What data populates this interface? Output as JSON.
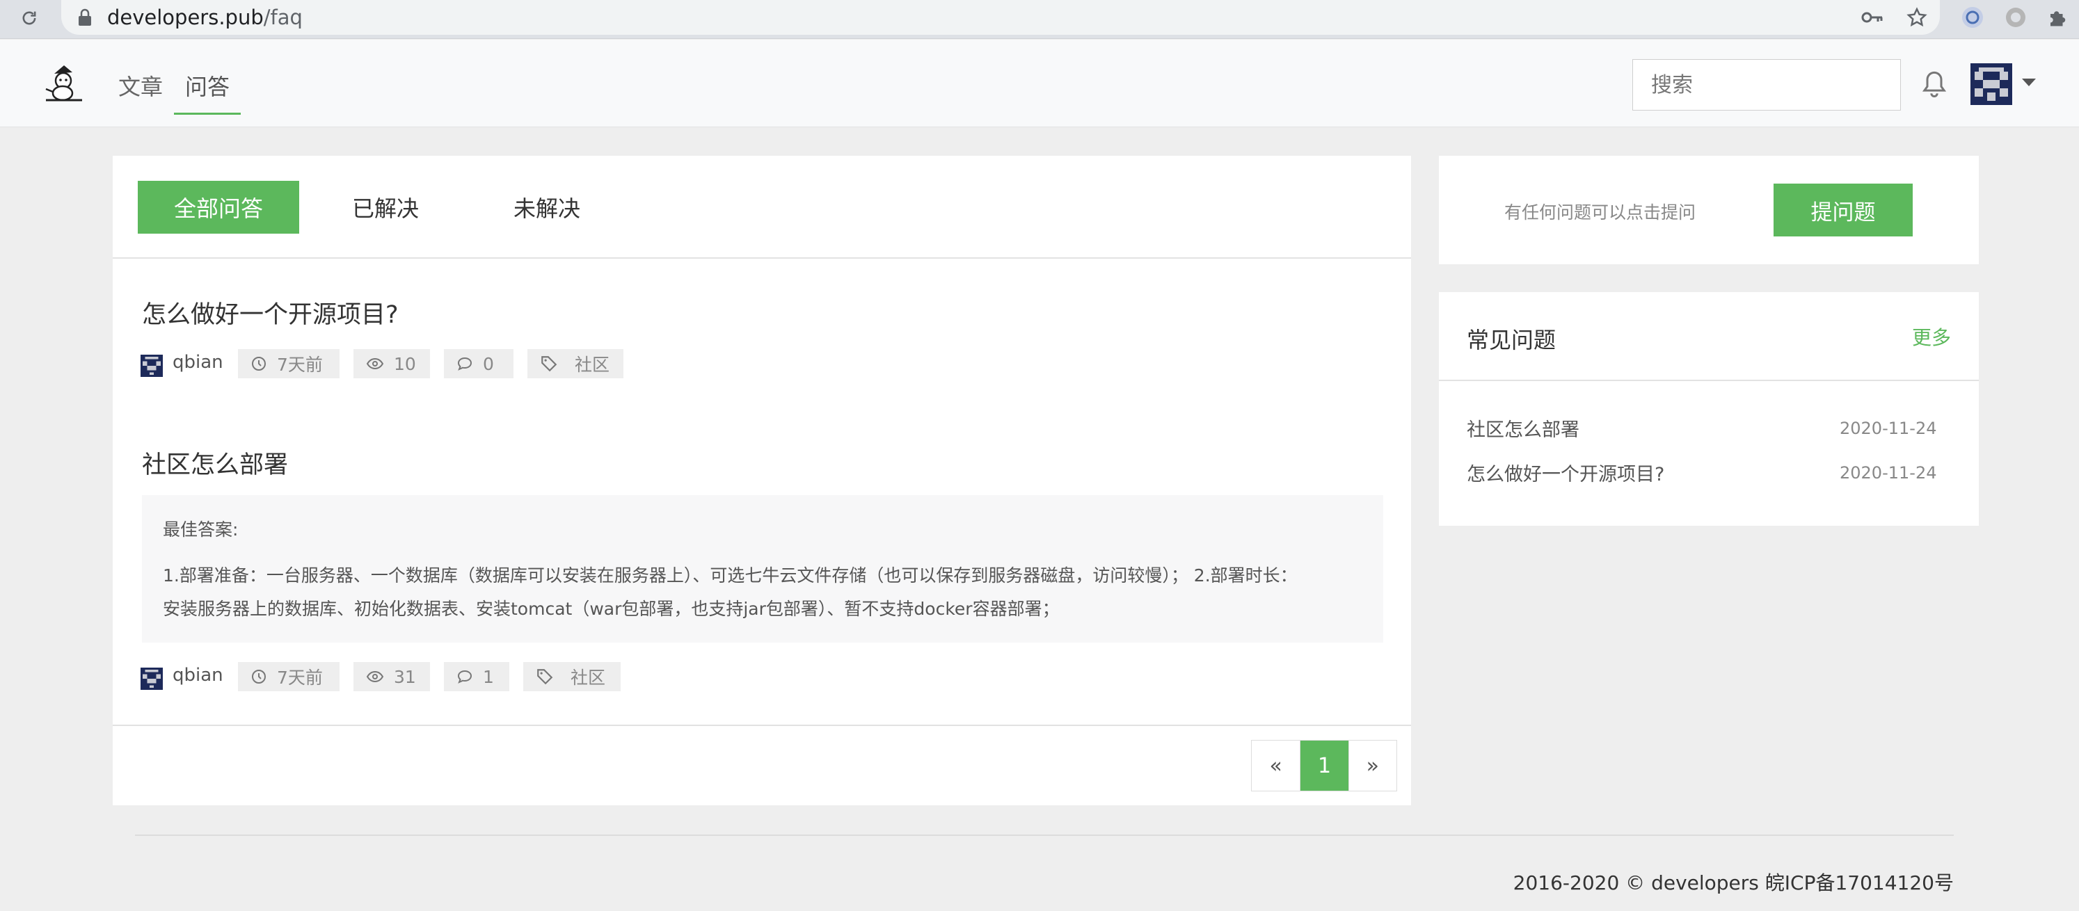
{
  "browser": {
    "url_host": "developers.pub",
    "url_path": "/faq"
  },
  "header": {
    "nav": [
      "文章",
      "问答"
    ],
    "active_nav": "问答",
    "search_placeholder": "搜索"
  },
  "tabs": {
    "items": [
      "全部问答",
      "已解决",
      "未解决"
    ],
    "active": "全部问答"
  },
  "questions": [
    {
      "title": "怎么做好一个开源项目?",
      "user": "qbian",
      "time": "7天前",
      "views": "10",
      "comments": "0",
      "tag": "社区"
    },
    {
      "title": "社区怎么部署",
      "best_answer_label": "最佳答案:",
      "best_answer_line1": "1.部署准备：一台服务器、一个数据库（数据库可以安装在服务器上）、可选七牛云文件存储（也可以保存到服务器磁盘，访问较慢）；  2.部署时长：",
      "best_answer_line2": "安装服务器上的数据库、初始化数据表、安装tomcat（war包部署，也支持jar包部署）、暂不支持docker容器部署；",
      "user": "qbian",
      "time": "7天前",
      "views": "31",
      "comments": "1",
      "tag": "社区"
    }
  ],
  "pagination": {
    "prev": "«",
    "current": "1",
    "next": "»"
  },
  "sidebar": {
    "ask_hint": "有任何问题可以点击提问",
    "ask_button": "提问题",
    "faq_title": "常见问题",
    "faq_more": "更多",
    "faq_items": [
      {
        "title": "社区怎么部署",
        "date": "2020-11-24"
      },
      {
        "title": "怎么做好一个开源项目?",
        "date": "2020-11-24"
      }
    ]
  },
  "footer": {
    "text": "2016-2020 © developers 皖ICP备17014120号"
  },
  "colors": {
    "accent": "#5cb85c",
    "page_bg": "#eeeeee",
    "chip_bg": "#eeeeee"
  },
  "icons": [
    "reload-icon",
    "lock-icon",
    "key-icon",
    "star-icon",
    "extension-icon",
    "puzzle-icon",
    "bell-icon",
    "clock-icon",
    "eye-icon",
    "comment-icon",
    "tag-icon"
  ]
}
